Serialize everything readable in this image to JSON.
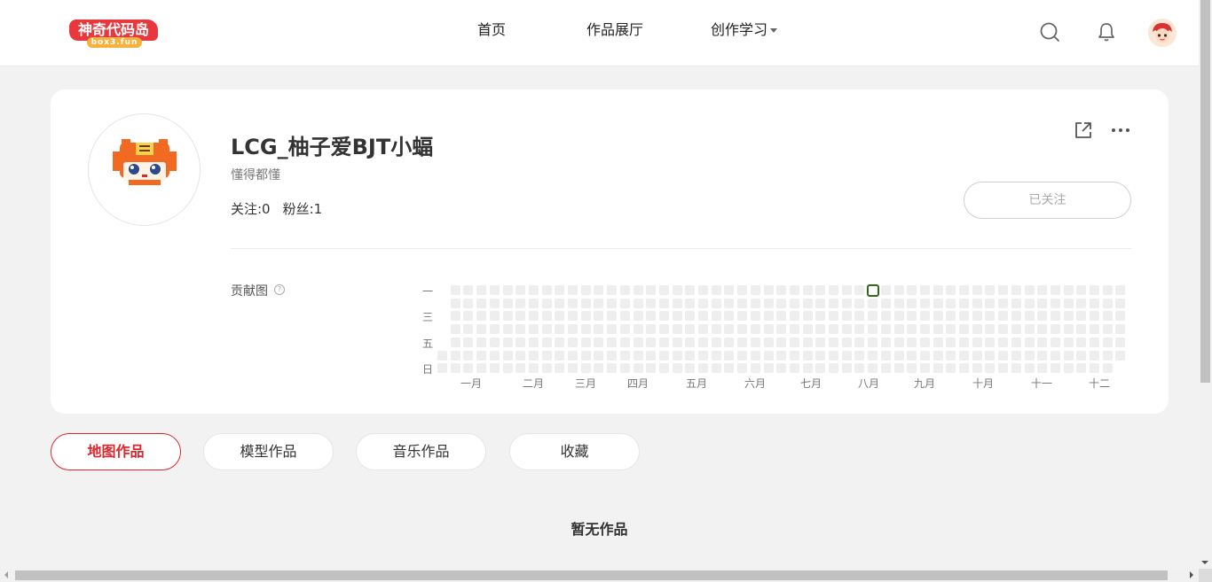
{
  "logo": {
    "main_text": "神奇代码岛",
    "sub_text": "box3.fun"
  },
  "nav": {
    "home": "首页",
    "gallery": "作品展厅",
    "learn": "创作学习"
  },
  "header_icons": [
    "search-icon",
    "bell-icon",
    "user-avatar"
  ],
  "profile": {
    "username": "LCG_柚子爱BJT小蝠",
    "bio": "懂得都懂",
    "following_label": "关注:0",
    "fans_label": "粉丝:1",
    "follow_button": "已关注"
  },
  "contribution": {
    "label": "贡献图",
    "day_labels": [
      "一",
      "三",
      "五",
      "日"
    ],
    "month_labels": [
      "一月",
      "二月",
      "三月",
      "四月",
      "五月",
      "六月",
      "七月",
      "八月",
      "九月",
      "十月",
      "十一",
      "十二"
    ],
    "weeks": 53,
    "active_cell": {
      "week": 33,
      "day": 0
    },
    "colors": {
      "empty": "#eeeeee",
      "active_border": "#2c6b18"
    }
  },
  "tabs": [
    {
      "label": "地图作品",
      "active": true
    },
    {
      "label": "模型作品",
      "active": false
    },
    {
      "label": "音乐作品",
      "active": false
    },
    {
      "label": "收藏",
      "active": false
    }
  ],
  "empty_message": "暂无作品",
  "colors": {
    "accent": "#e0262c",
    "page_bg": "#f2f2f2"
  }
}
